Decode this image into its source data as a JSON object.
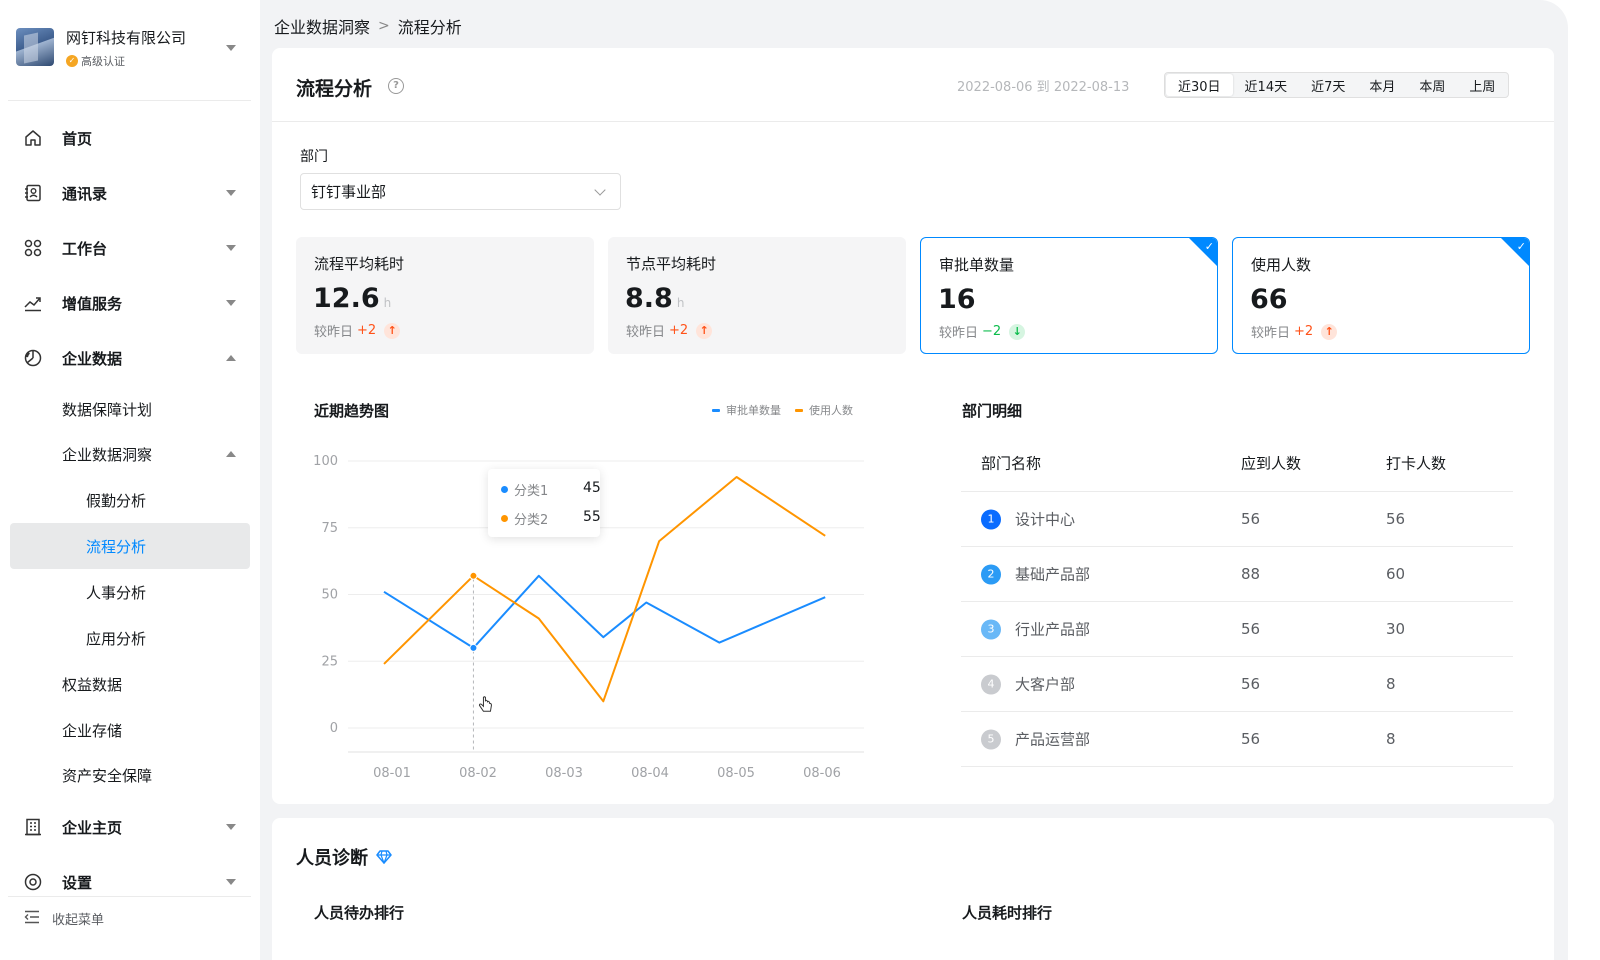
{
  "org": {
    "name": "网钉科技有限公司",
    "badge": "高级认证"
  },
  "nav": {
    "home": "首页",
    "contacts": "通讯录",
    "workbench": "工作台",
    "value_added": "增值服务",
    "enterprise_data": "企业数据",
    "data_plan": "数据保障计划",
    "data_insight": "企业数据洞察",
    "attendance": "假勤分析",
    "process": "流程分析",
    "hr": "人事分析",
    "app": "应用分析",
    "rights": "权益数据",
    "storage": "企业存储",
    "asset_security": "资产安全保障",
    "homepage": "企业主页",
    "settings": "设置",
    "collapse": "收起菜单"
  },
  "breadcrumb": {
    "parent": "企业数据洞察",
    "sep": ">",
    "current": "流程分析"
  },
  "header": {
    "title": "流程分析",
    "help": "?",
    "date_range": "2022-08-06 到 2022-08-13",
    "ranges": [
      "近30日",
      "近14天",
      "近7天",
      "本月",
      "本周",
      "上周"
    ],
    "active_range": "近30日"
  },
  "filter": {
    "label": "部门",
    "value": "钉钉事业部"
  },
  "metrics": [
    {
      "label": "流程平均耗时",
      "value": "12.6",
      "unit": "h",
      "cmp_label": "较昨日",
      "delta": "+2",
      "direction": "up",
      "selected": false
    },
    {
      "label": "节点平均耗时",
      "value": "8.8",
      "unit": "h",
      "cmp_label": "较昨日",
      "delta": "+2",
      "direction": "up",
      "selected": false
    },
    {
      "label": "审批单数量",
      "value": "16",
      "unit": "",
      "cmp_label": "较昨日",
      "delta": "−2",
      "direction": "down",
      "selected": true
    },
    {
      "label": "使用人数",
      "value": "66",
      "unit": "",
      "cmp_label": "较昨日",
      "delta": "+2",
      "direction": "up",
      "selected": true
    }
  ],
  "trend": {
    "title": "近期趋势图"
  },
  "tooltip": {
    "rows": [
      {
        "name": "分类1",
        "value": "45",
        "color": "#1a8cff"
      },
      {
        "name": "分类2",
        "value": "55",
        "color": "#ff9500"
      }
    ]
  },
  "chart_data": {
    "type": "line",
    "title": "近期趋势图",
    "x": [
      "08-01",
      "08-02",
      "08-03",
      "08-04",
      "08-05",
      "08-06"
    ],
    "y_ticks": [
      0,
      25,
      50,
      75,
      100
    ],
    "ylim": [
      0,
      100
    ],
    "x_positions": [
      0,
      1,
      2,
      3,
      4,
      5,
      6,
      7,
      8,
      9,
      10,
      11
    ],
    "series": [
      {
        "name": "审批单数量",
        "color": "#1a8cff",
        "points": [
          [
            0,
            51
          ],
          [
            1.04,
            30
          ],
          [
            1.8,
            57
          ],
          [
            2.55,
            34
          ],
          [
            3.05,
            47
          ],
          [
            3.9,
            32
          ],
          [
            5.13,
            49
          ]
        ]
      },
      {
        "name": "使用人数",
        "color": "#ff9500",
        "points": [
          [
            0,
            24
          ],
          [
            1.04,
            57
          ],
          [
            1.8,
            41
          ],
          [
            2.55,
            10
          ],
          [
            3.2,
            70
          ],
          [
            4.1,
            94
          ],
          [
            5.13,
            72
          ]
        ]
      }
    ],
    "highlight_x": 1.04,
    "legend": "top-right",
    "grid": true
  },
  "dept": {
    "title": "部门明细",
    "columns": [
      "部门名称",
      "应到人数",
      "打卡人数"
    ],
    "rows": [
      {
        "rank": "1",
        "name": "设计中心",
        "expected": "56",
        "checked": "56",
        "color": "#0a6cff"
      },
      {
        "rank": "2",
        "name": "基础产品部",
        "expected": "88",
        "checked": "60",
        "color": "#2b9bf5"
      },
      {
        "rank": "3",
        "name": "行业产品部",
        "expected": "56",
        "checked": "30",
        "color": "#69b8f7"
      },
      {
        "rank": "4",
        "name": "大客户部",
        "expected": "56",
        "checked": "8",
        "color": "#c9cbcf"
      },
      {
        "rank": "5",
        "name": "产品运营部",
        "expected": "56",
        "checked": "8",
        "color": "#c9cbcf"
      }
    ]
  },
  "diagnosis": {
    "title": "人员诊断",
    "pending_rank": "人员待办排行",
    "time_rank": "人员耗时排行"
  }
}
